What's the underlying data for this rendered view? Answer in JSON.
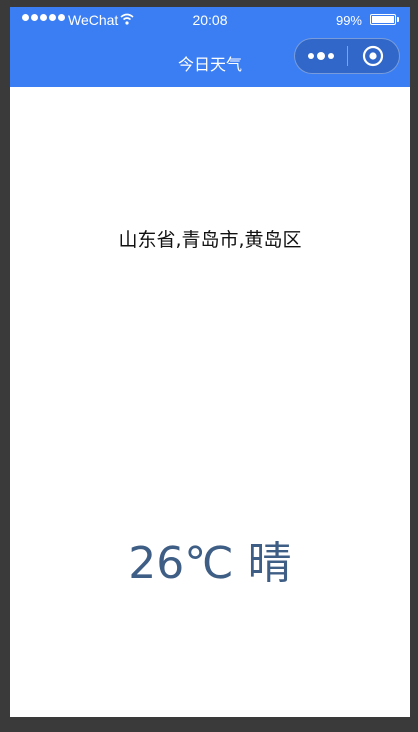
{
  "status_bar": {
    "carrier": "WeChat",
    "time": "20:08",
    "battery_percent": "99%",
    "battery_level": 0.99,
    "signal_icon": "signal-dots-icon",
    "wifi_icon": "wifi-icon",
    "battery_icon": "battery-icon"
  },
  "nav": {
    "title": "今日天气",
    "menu_icon": "more-dots-icon",
    "close_icon": "target-circle-icon"
  },
  "content": {
    "location": "山东省,青岛市,黄岛区",
    "weather": "26℃ 晴"
  },
  "colors": {
    "header_bg": "#3b7ef4",
    "weather_text": "#3f5e85"
  }
}
